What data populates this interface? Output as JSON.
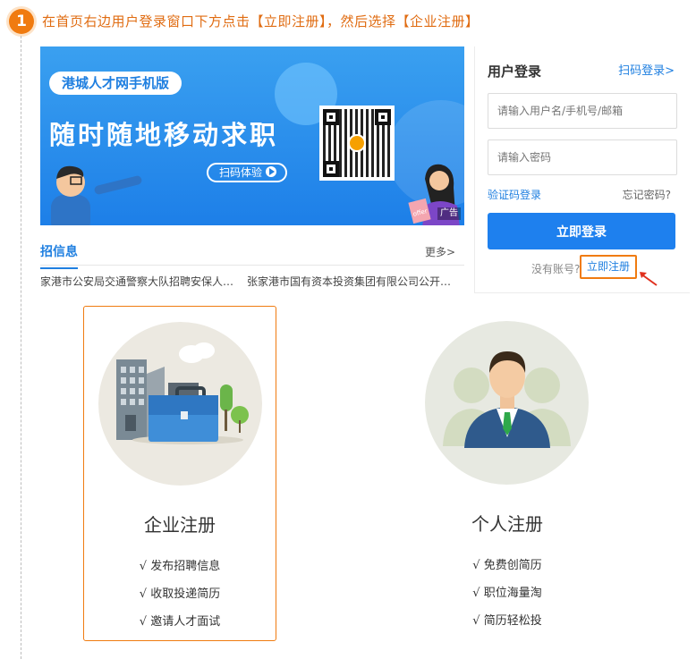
{
  "step": {
    "number": "1",
    "instruction": "在首页右边用户登录窗口下方点击【立即注册】，然后选择【企业注册】"
  },
  "banner": {
    "pill_text": "港城人才网手机版",
    "slogan": "随时随地移动求职",
    "scan_button": "扫码体验",
    "ad_tag": "广告",
    "offer_text": "offer"
  },
  "news": {
    "tab_label": "招信息",
    "more_label": "更多>",
    "items": [
      "家港市公安局交通警察大队招聘安保人…",
      "张家港市国有资本投资集团有限公司公开…"
    ]
  },
  "login": {
    "title": "用户登录",
    "scan_login": "扫码登录>",
    "username_placeholder": "请输入用户名/手机号/邮箱",
    "password_placeholder": "请输入密码",
    "sms_login": "验证码登录",
    "forgot_password": "忘记密码?",
    "login_button": "立即登录",
    "no_account": "没有账号?",
    "register_link": "立即注册"
  },
  "registration": {
    "enterprise": {
      "title": "企业注册",
      "features": [
        "√ 发布招聘信息",
        "√ 收取投递简历",
        "√ 邀请人才面试"
      ]
    },
    "personal": {
      "title": "个人注册",
      "features": [
        "√ 免费创简历",
        "√ 职位海量淘",
        "√ 简历轻松投"
      ]
    }
  },
  "colors": {
    "accent_orange": "#f07b10",
    "brand_blue": "#1e80ee",
    "banner_blue": "#2b8ef0"
  }
}
